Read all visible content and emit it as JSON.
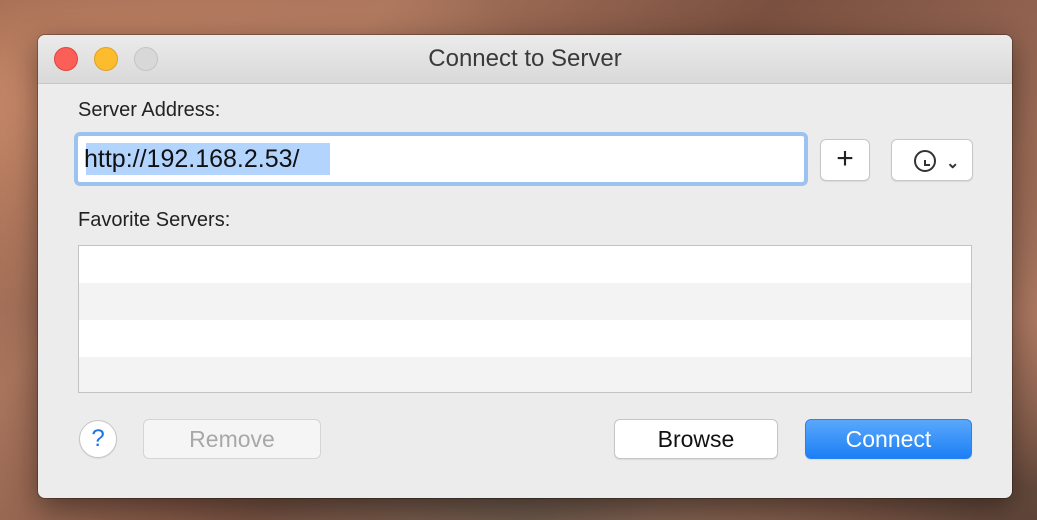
{
  "window": {
    "title": "Connect to Server"
  },
  "server_address": {
    "label": "Server Address:",
    "value": "http://192.168.2.53/"
  },
  "toolbar": {
    "add_label": "+",
    "recent_icon": "clock-icon",
    "recent_chevron": "⌄"
  },
  "favorites": {
    "label": "Favorite Servers:",
    "rows": []
  },
  "buttons": {
    "help_label": "?",
    "remove_label": "Remove",
    "browse_label": "Browse",
    "connect_label": "Connect"
  },
  "colors": {
    "accent": "#1c7ff5",
    "close": "#fc5f57",
    "minimize": "#fdbc2e",
    "zoom_disabled": "#d8d8d8"
  }
}
